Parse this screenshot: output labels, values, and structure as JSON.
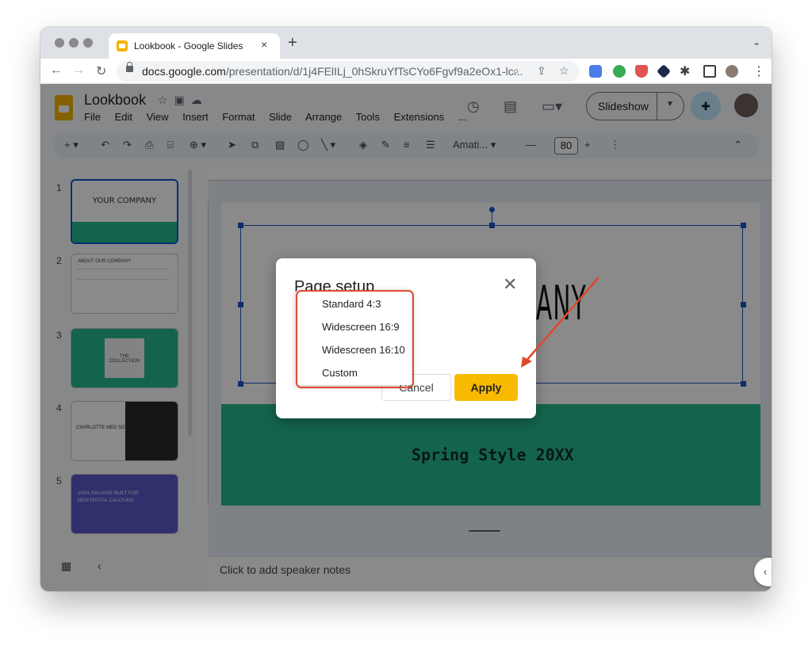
{
  "browser": {
    "tab_title": "Lookbook - Google Slides",
    "tab_close": "×",
    "new_tab": "+",
    "tab_dropdown": "⌄",
    "url_domain": "docs.google.com",
    "url_path": "/presentation/d/1j4FElILj_0hSkruYfTsCYo6Fgvf9a2eOx1-lc..."
  },
  "doc": {
    "title": "Lookbook",
    "menu": [
      "File",
      "Edit",
      "View",
      "Insert",
      "Format",
      "Slide",
      "Arrange",
      "Tools",
      "Extensions",
      "..."
    ],
    "slideshow_label": "Slideshow"
  },
  "toolbar": {
    "font": "Amati...",
    "font_size": "80"
  },
  "filmstrip": {
    "numbers": [
      "1",
      "2",
      "3",
      "4",
      "5"
    ],
    "slide1_title": "YOUR COMPANY",
    "slide3_title": "THE COLLECTION",
    "slide4_title": "CHARLOTTE MED SOUT",
    "slide5_text": "100% SALVAGE BUILT FOR NEW DIGITAL CALCIUMS",
    "slide2_title": "ABOUT OUR COMPANY"
  },
  "slide": {
    "title_fragment": "PANY",
    "band_text": "Spring Style 20XX"
  },
  "notes": {
    "placeholder": "Click to add speaker notes"
  },
  "dialog": {
    "title": "Page setup",
    "close": "✕",
    "cancel": "Cancel",
    "apply": "Apply",
    "options": [
      "Standard 4:3",
      "Widescreen 16:9",
      "Widescreen 16:10",
      "Custom"
    ]
  },
  "colors": {
    "accent_band": "#26b98f",
    "apply_button": "#f9bb00",
    "selection": "#1a56c0",
    "annotation": "#e0492f"
  }
}
